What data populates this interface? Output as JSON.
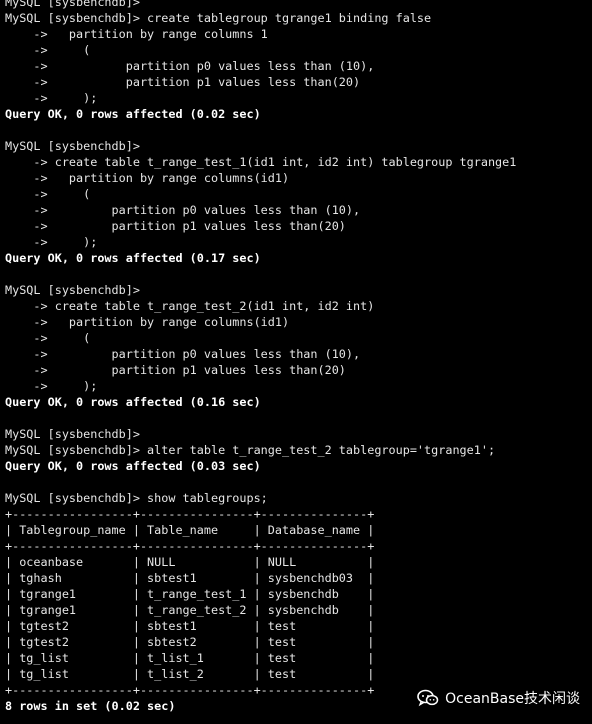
{
  "terminal": {
    "lines": [
      {
        "text": "MySQL [sysbenchdb]>",
        "bold": false
      },
      {
        "text": "MySQL [sysbenchdb]> create tablegroup tgrange1 binding false",
        "bold": false
      },
      {
        "text": "    ->   partition by range columns 1",
        "bold": false
      },
      {
        "text": "    ->     (",
        "bold": false
      },
      {
        "text": "    ->           partition p0 values less than (10),",
        "bold": false
      },
      {
        "text": "    ->           partition p1 values less than(20)",
        "bold": false
      },
      {
        "text": "    ->     );",
        "bold": false
      },
      {
        "text": "Query OK, 0 rows affected (0.02 sec)",
        "bold": true
      },
      {
        "text": "",
        "bold": false
      },
      {
        "text": "MySQL [sysbenchdb]>",
        "bold": false
      },
      {
        "text": "    -> create table t_range_test_1(id1 int, id2 int) tablegroup tgrange1",
        "bold": false
      },
      {
        "text": "    ->   partition by range columns(id1)",
        "bold": false
      },
      {
        "text": "    ->     (",
        "bold": false
      },
      {
        "text": "    ->         partition p0 values less than (10),",
        "bold": false
      },
      {
        "text": "    ->         partition p1 values less than(20)",
        "bold": false
      },
      {
        "text": "    ->     );",
        "bold": false
      },
      {
        "text": "Query OK, 0 rows affected (0.17 sec)",
        "bold": true
      },
      {
        "text": "",
        "bold": false
      },
      {
        "text": "MySQL [sysbenchdb]>",
        "bold": false
      },
      {
        "text": "    -> create table t_range_test_2(id1 int, id2 int)",
        "bold": false
      },
      {
        "text": "    ->   partition by range columns(id1)",
        "bold": false
      },
      {
        "text": "    ->     (",
        "bold": false
      },
      {
        "text": "    ->         partition p0 values less than (10),",
        "bold": false
      },
      {
        "text": "    ->         partition p1 values less than(20)",
        "bold": false
      },
      {
        "text": "    ->     );",
        "bold": false
      },
      {
        "text": "Query OK, 0 rows affected (0.16 sec)",
        "bold": true
      },
      {
        "text": "",
        "bold": false
      },
      {
        "text": "MySQL [sysbenchdb]>",
        "bold": false
      },
      {
        "text": "MySQL [sysbenchdb]> alter table t_range_test_2 tablegroup='tgrange1';",
        "bold": false
      },
      {
        "text": "Query OK, 0 rows affected (0.03 sec)",
        "bold": true
      },
      {
        "text": "",
        "bold": false
      },
      {
        "text": "MySQL [sysbenchdb]> show tablegroups;",
        "bold": false
      },
      {
        "text": "+-----------------+----------------+---------------+",
        "bold": false
      },
      {
        "text": "| Tablegroup_name | Table_name     | Database_name |",
        "bold": false
      },
      {
        "text": "+-----------------+----------------+---------------+",
        "bold": false
      },
      {
        "text": "| oceanbase       | NULL           | NULL          |",
        "bold": false
      },
      {
        "text": "| tghash          | sbtest1        | sysbenchdb03  |",
        "bold": false
      },
      {
        "text": "| tgrange1        | t_range_test_1 | sysbenchdb    |",
        "bold": false
      },
      {
        "text": "| tgrange1        | t_range_test_2 | sysbenchdb    |",
        "bold": false
      },
      {
        "text": "| tgtest2         | sbtest1        | test          |",
        "bold": false
      },
      {
        "text": "| tgtest2         | sbtest2        | test          |",
        "bold": false
      },
      {
        "text": "| tg_list         | t_list_1       | test          |",
        "bold": false
      },
      {
        "text": "| tg_list         | t_list_2       | test          |",
        "bold": false
      },
      {
        "text": "+-----------------+----------------+---------------+",
        "bold": false
      },
      {
        "text": "8 rows in set (0.02 sec)",
        "bold": true
      }
    ]
  },
  "watermark": {
    "icon": "wechat-icon",
    "label": "OceanBase技术闲谈"
  },
  "colors": {
    "background": "#000000",
    "text": "#e6e6e6",
    "bold_text": "#ffffff"
  }
}
